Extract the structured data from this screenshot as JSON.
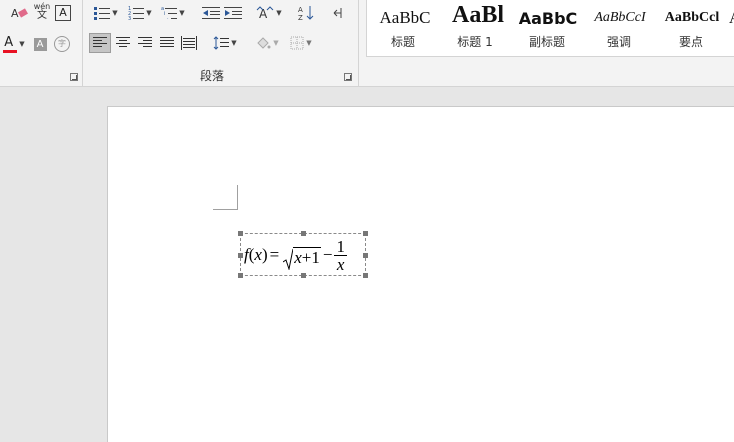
{
  "ribbon": {
    "paragraph_group_label": "段落",
    "font_row1": {
      "phonetic_icon_text": "wén",
      "phonetic_icon_char": "文",
      "border_char": "A",
      "eraser": "A"
    },
    "font_row2": {
      "font_color_char": "A",
      "highlight_char": "A",
      "enclose_char": "字"
    },
    "sort_label": "A↓Z"
  },
  "styles": [
    {
      "sample": "AaBbC",
      "name": "标题"
    },
    {
      "sample": "AaBl",
      "name": "标题 1"
    },
    {
      "sample": "AaBbC",
      "name": "副标题"
    },
    {
      "sample": "AaBbCcI",
      "name": "强调"
    },
    {
      "sample": "AaBbCcl",
      "name": "要点"
    }
  ],
  "equation": {
    "f": "f",
    "lp": "(",
    "x": "x",
    "rp": ")",
    "eq": "=",
    "radicand_x": "x",
    "plus": "+",
    "one": "1",
    "minus": "−",
    "frac_num": "1",
    "frac_den": "x"
  },
  "colors": {
    "font_color_bar": "#e81123",
    "highlight": "#7a7a7a"
  }
}
